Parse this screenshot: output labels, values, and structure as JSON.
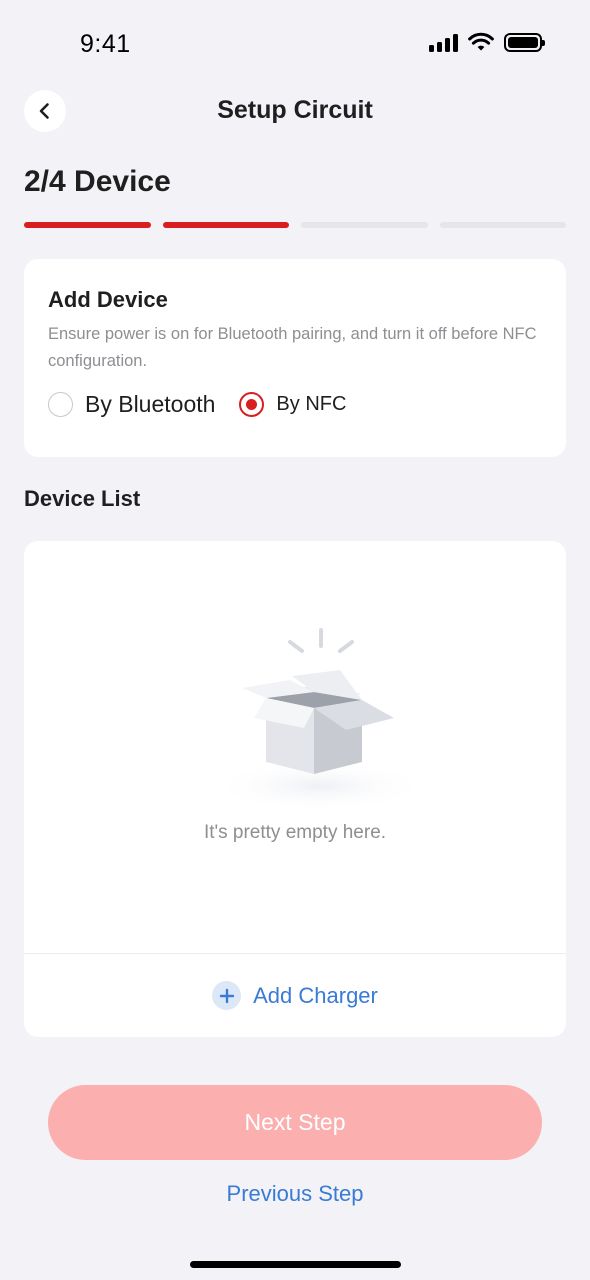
{
  "status_bar": {
    "time": "9:41",
    "signal_icon": "cellular-signal-icon",
    "wifi_icon": "wifi-icon",
    "battery_icon": "battery-icon"
  },
  "header": {
    "back_icon": "chevron-left-icon",
    "title": "Setup Circuit"
  },
  "step": {
    "title": "2/4 Device",
    "current": 2,
    "total": 4,
    "accent_color": "#D81E1E"
  },
  "add_device": {
    "title": "Add Device",
    "description": "Ensure power is on for Bluetooth pairing, and turn it off before NFC configuration.",
    "options": [
      {
        "label": "By Bluetooth",
        "selected": false
      },
      {
        "label": "By NFC",
        "selected": true
      }
    ]
  },
  "device_list": {
    "title": "Device List",
    "empty_icon": "empty-box-illustration",
    "empty_text": "It's pretty empty here.",
    "add_label": "Add Charger",
    "add_icon": "plus-circle-icon"
  },
  "footer": {
    "next_label": "Next Step",
    "prev_label": "Previous Step",
    "link_color": "#3A7BD5"
  }
}
